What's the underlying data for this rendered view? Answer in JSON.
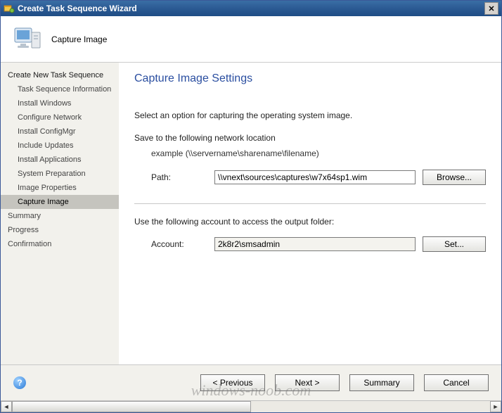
{
  "window": {
    "title": "Create Task Sequence Wizard",
    "close_glyph": "✕"
  },
  "header": {
    "title": "Capture Image"
  },
  "sidebar": {
    "heading": "Create New Task Sequence",
    "items": [
      {
        "label": "Task Sequence Information",
        "level": 1,
        "active": false
      },
      {
        "label": "Install Windows",
        "level": 1,
        "active": false
      },
      {
        "label": "Configure Network",
        "level": 1,
        "active": false
      },
      {
        "label": "Install ConfigMgr",
        "level": 1,
        "active": false
      },
      {
        "label": "Include Updates",
        "level": 1,
        "active": false
      },
      {
        "label": "Install Applications",
        "level": 1,
        "active": false
      },
      {
        "label": "System Preparation",
        "level": 1,
        "active": false
      },
      {
        "label": "Image Properties",
        "level": 1,
        "active": false
      },
      {
        "label": "Capture Image",
        "level": 1,
        "active": true
      },
      {
        "label": "Summary",
        "level": 0,
        "active": false
      },
      {
        "label": "Progress",
        "level": 0,
        "active": false
      },
      {
        "label": "Confirmation",
        "level": 0,
        "active": false
      }
    ]
  },
  "main": {
    "page_title": "Capture Image Settings",
    "intro": "Select an option for capturing the operating system image.",
    "save_label": "Save to the following network location",
    "example": "example (\\\\servername\\sharename\\filename)",
    "path_label": "Path:",
    "path_value": "\\\\vnext\\sources\\captures\\w7x64sp1.wim",
    "browse_label": "Browse...",
    "account_section": "Use the following account to access the output folder:",
    "account_label": "Account:",
    "account_value": "2k8r2\\smsadmin",
    "set_label": "Set..."
  },
  "footer": {
    "previous": "< Previous",
    "next": "Next >",
    "summary": "Summary",
    "cancel": "Cancel"
  },
  "watermark": "windows-noob.com"
}
